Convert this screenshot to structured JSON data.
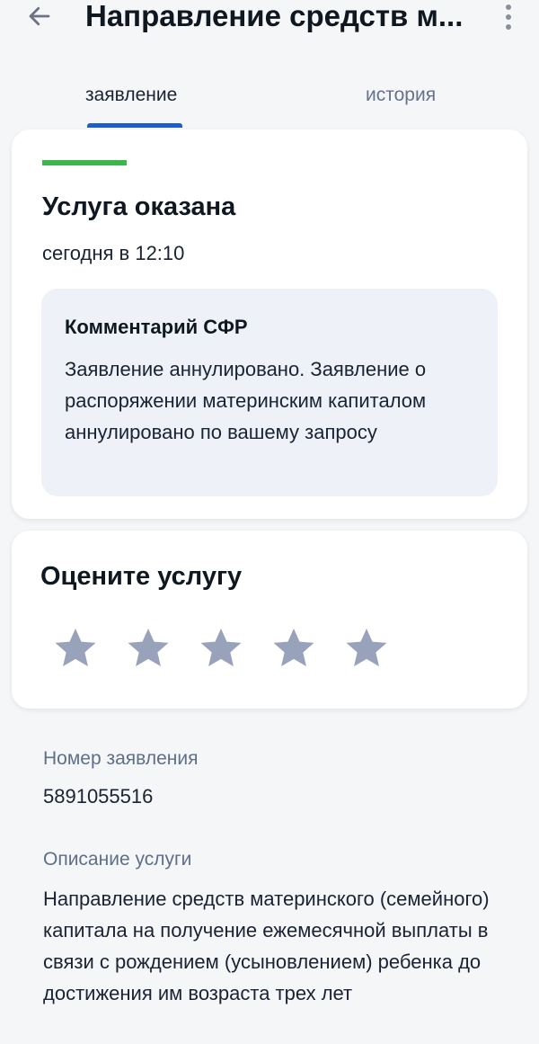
{
  "app_bar": {
    "title": "Направление средств м...",
    "back_icon": "arrow-left-icon",
    "more_icon": "more-vertical-icon"
  },
  "tabs": [
    {
      "label": "заявление",
      "active": true
    },
    {
      "label": "история",
      "active": false
    }
  ],
  "status": {
    "color": "#3cb64a",
    "title": "Услуга оказана",
    "time": "сегодня в 12:10",
    "comment": {
      "title": "Комментарий СФР",
      "text": "Заявление аннулировано. Заявление о распоряжении материнским капиталом аннулировано по вашему запросу"
    }
  },
  "rating": {
    "title": "Оцените услугу",
    "max_stars": 5,
    "selected_stars": 0,
    "star_color": "#98a3bb"
  },
  "application": {
    "number_label": "Номер заявления",
    "number": "5891055516",
    "description_label": "Описание услуги",
    "description": "Направление средств материнского (семейного) капитала на получение ежемесячной выплаты в связи с рождением (усыновлением) ребенка до достижения им возраста трех лет"
  },
  "colors": {
    "accent": "#1e5ec8",
    "background": "#f5f6f8",
    "card": "#ffffff",
    "comment_bg": "#eef2f8"
  }
}
